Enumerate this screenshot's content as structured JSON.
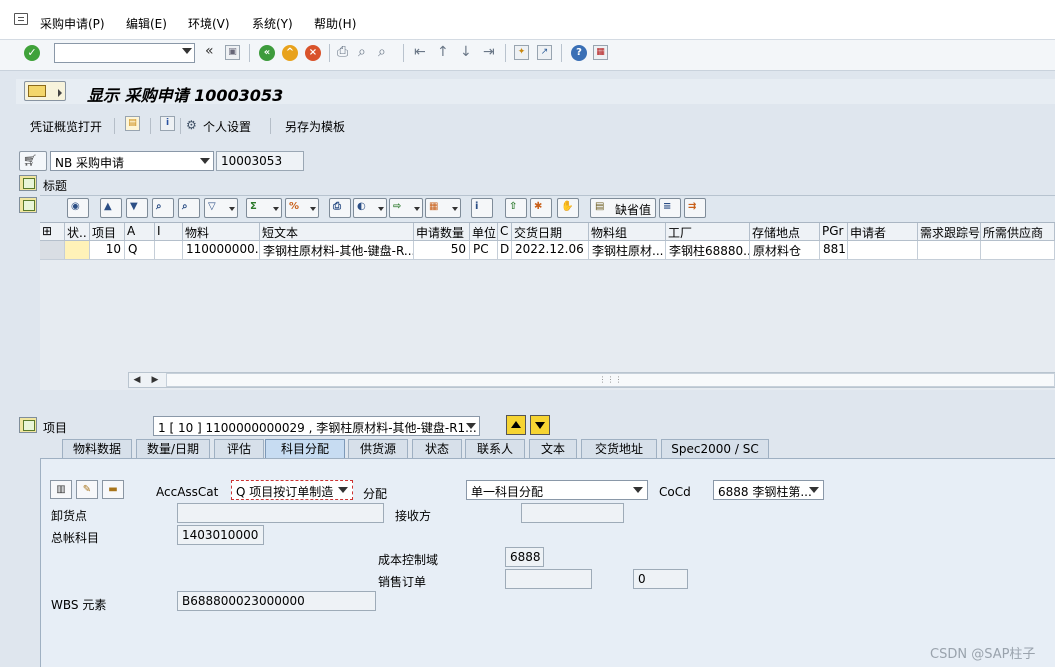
{
  "menu": [
    "采购申请(P)",
    "编辑(E)",
    "环境(V)",
    "系统(Y)",
    "帮助(H)"
  ],
  "toolbar": {
    "nav_back": "«",
    "ok_icon": "check-icon"
  },
  "title": "显示 采购申请 10003053",
  "app_toolbar": {
    "overview": "凭证概览打开",
    "personal_settings": "个人设置",
    "save_template": "另存为模板"
  },
  "header": {
    "doc_type": "NB 采购申请",
    "doc_number": "10003053",
    "section_label": "标题"
  },
  "grid": {
    "default_values_btn": "缺省值",
    "columns": [
      "",
      "状..",
      "项目",
      "A",
      "I",
      "物料",
      "短文本",
      "申请数量",
      "单位",
      "C",
      "交货日期",
      "物料组",
      "工厂",
      "存储地点",
      "PGr",
      "申请者",
      "需求跟踪号",
      "所需供应商"
    ],
    "row": [
      "",
      "",
      "10",
      "Q",
      "",
      "110000000...",
      "李钢柱原材料-其他-键盘-R...",
      "50",
      "PC",
      "D",
      "2022.12.06",
      "李钢柱原材...",
      "李钢柱68880...",
      "原材料仓",
      "881",
      "",
      "",
      ""
    ]
  },
  "item": {
    "label": "项目",
    "selected": "1 [ 10 ] 1100000000029 , 李钢柱原材料-其他-键盘-R1..."
  },
  "tabs": [
    "物料数据",
    "数量/日期",
    "评估",
    "科目分配",
    "供货源",
    "状态",
    "联系人",
    "文本",
    "交货地址",
    "Spec2000 / SC"
  ],
  "active_tab": "科目分配",
  "account": {
    "acc_ass_cat_label": "AccAssCat",
    "acc_ass_cat_value": "Q 项目按订单制造",
    "distribution_label": "分配",
    "distribution_value": "单一科目分配",
    "cocd_label": "CoCd",
    "cocd_value": "6888 李钢柱第...",
    "unloading_point_label": "卸货点",
    "unloading_point_value": "",
    "recipient_label": "接收方",
    "recipient_value": "",
    "gl_account_label": "总帐科目",
    "gl_account_value": "1403010000",
    "controlling_area_label": "成本控制域",
    "controlling_area_value": "6888",
    "sales_order_label": "销售订单",
    "sales_order_value": "",
    "sales_order_item_value": "0",
    "wbs_label": "WBS 元素",
    "wbs_value": "B688800023000000"
  },
  "watermark": "CSDN @SAP柱子"
}
